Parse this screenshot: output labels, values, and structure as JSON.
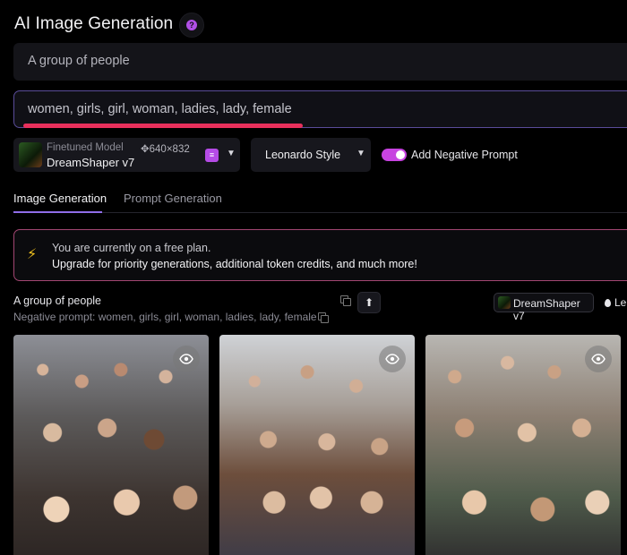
{
  "header": {
    "title": "AI Image Generation"
  },
  "prompt": {
    "value": "A group of people"
  },
  "negative_prompt": {
    "value": "women, girls, girl, woman, ladies, lady, female"
  },
  "model_select": {
    "label": "Finetuned Model",
    "dimensions": "640×832",
    "name": "DreamShaper v7"
  },
  "style_select": {
    "value": "Leonardo Style"
  },
  "negative_toggle": {
    "label": "Add Negative Prompt",
    "on": true
  },
  "tabs": [
    {
      "label": "Image Generation",
      "active": true
    },
    {
      "label": "Prompt Generation",
      "active": false
    }
  ],
  "banner": {
    "line1": "You are currently on a free plan.",
    "line2": "Upgrade for priority generations, additional token credits, and much more!"
  },
  "generation": {
    "prompt": "A group of people",
    "negative": "Negative prompt: women, girls, girl, woman, ladies, lady, female",
    "model_chip": "DreamShaper v7",
    "style_chip": "Le"
  },
  "icons": {
    "help": "question-icon",
    "bolt": "lightning-icon",
    "copy": "copy-icon",
    "upload": "arrow-up-icon",
    "view": "eye-icon"
  },
  "colors": {
    "accent": "#c743e0",
    "underline": "#e8305c",
    "bolt": "#f3c21f"
  }
}
